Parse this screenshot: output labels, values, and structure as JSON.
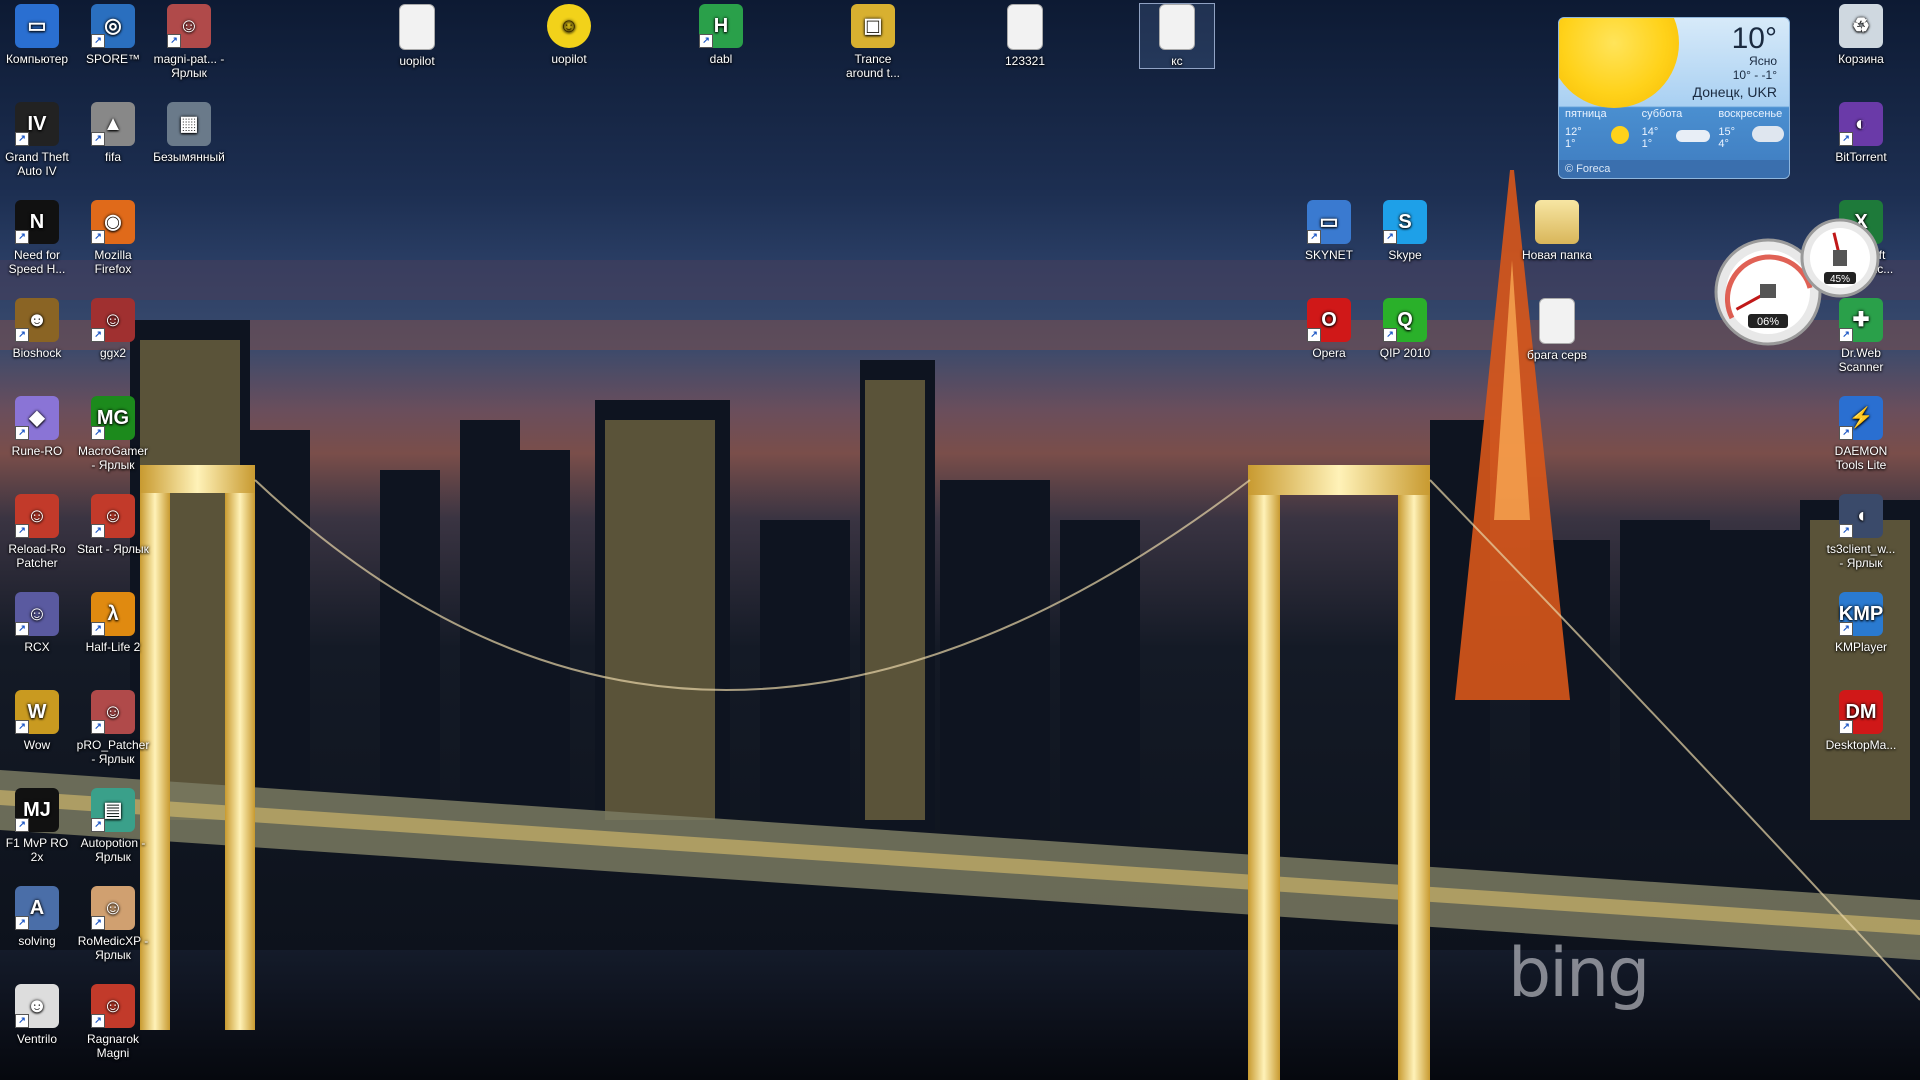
{
  "desktop": {
    "icons_left_col1": [
      {
        "label": "Компьютер",
        "icon": "computer-icon",
        "color": "#2a6fd1",
        "shortcut": false
      },
      {
        "label": "Grand Theft Auto IV",
        "icon": "gta4-icon",
        "color": "#222222",
        "shortcut": true
      },
      {
        "label": "Need for Speed H...",
        "icon": "nfs-icon",
        "color": "#111111",
        "shortcut": true
      },
      {
        "label": "Bioshock",
        "icon": "bioshock-icon",
        "color": "#8a6424",
        "shortcut": true
      },
      {
        "label": "Rune-RO",
        "icon": "rune-ro-icon",
        "color": "#8a74d6",
        "shortcut": true
      },
      {
        "label": "Reload-Ro Patcher",
        "icon": "reload-ro-icon",
        "color": "#c23a2a",
        "shortcut": true
      },
      {
        "label": "RCX",
        "icon": "rcx-icon",
        "color": "#5a5aa0",
        "shortcut": true
      },
      {
        "label": "Wow",
        "icon": "wow-icon",
        "color": "#c99a20",
        "shortcut": true
      },
      {
        "label": "F1 MvP RO 2x",
        "icon": "f1-mvp-icon",
        "color": "#111111",
        "shortcut": true
      },
      {
        "label": "solving",
        "icon": "solving-icon",
        "color": "#4a6ea8",
        "shortcut": true
      },
      {
        "label": "Ventrilo",
        "icon": "ventrilo-icon",
        "color": "#dddddd",
        "shortcut": true
      }
    ],
    "icons_left_col2": [
      {
        "label": "SPORE™",
        "icon": "spore-icon",
        "color": "#2a6fbf",
        "shortcut": true
      },
      {
        "label": "fifa",
        "icon": "fifa-icon",
        "color": "#888888",
        "shortcut": true
      },
      {
        "label": "Mozilla Firefox",
        "icon": "firefox-icon",
        "color": "#e06a1a",
        "shortcut": true
      },
      {
        "label": "ggx2",
        "icon": "ggx2-icon",
        "color": "#a03030",
        "shortcut": true
      },
      {
        "label": "MacroGamer - Ярлык",
        "icon": "macrogamer-icon",
        "color": "#1c8a1c",
        "shortcut": true
      },
      {
        "label": "Start - Ярлык",
        "icon": "start-icon",
        "color": "#c23a2a",
        "shortcut": true
      },
      {
        "label": "Half-Life 2",
        "icon": "half-life-icon",
        "color": "#e08a10",
        "shortcut": true
      },
      {
        "label": "pRO_Patcher - Ярлык",
        "icon": "pro-patcher-icon",
        "color": "#b04a4a",
        "shortcut": true
      },
      {
        "label": "Autopotion - Ярлык",
        "icon": "autopotion-icon",
        "color": "#3aa08a",
        "shortcut": true
      },
      {
        "label": "RoMedicXP - Ярлык",
        "icon": "romedic-icon",
        "color": "#d0a070",
        "shortcut": true
      },
      {
        "label": "Ragnarok Magni",
        "icon": "ragnarok-icon",
        "color": "#c23a2a",
        "shortcut": true
      }
    ],
    "icons_left_col3": [
      {
        "label": "magni-pat... - Ярлык",
        "icon": "magni-patcher-icon",
        "color": "#b04a4a",
        "shortcut": true
      },
      {
        "label": "Безымянный",
        "icon": "image-file-icon",
        "color": "#6a7a8a",
        "shortcut": false
      }
    ],
    "icons_top": [
      {
        "label": "uopilot",
        "icon": "text-file-icon",
        "color": "#f2f2f2",
        "shortcut": false
      },
      {
        "label": "uopilot",
        "icon": "smiley-icon",
        "color": "#f2d21a",
        "shortcut": false
      },
      {
        "label": "dabl",
        "icon": "dabl-icon",
        "color": "#2aa04a",
        "shortcut": true
      },
      {
        "label": "Trance around t...",
        "icon": "media-file-icon",
        "color": "#d8b030",
        "shortcut": false
      },
      {
        "label": "123321",
        "icon": "text-file-icon",
        "color": "#f2f2f2",
        "shortcut": false
      },
      {
        "label": "кс",
        "icon": "text-file-icon",
        "color": "#f2f2f2",
        "shortcut": false
      }
    ],
    "icons_mid": [
      {
        "label": "SKYNET",
        "icon": "network-computer-icon",
        "color": "#3a7ad0",
        "shortcut": true
      },
      {
        "label": "Skype",
        "icon": "skype-icon",
        "color": "#1ea0e8",
        "shortcut": true
      },
      {
        "label": "Новая папка",
        "icon": "folder-icon",
        "color": "#e8cc70",
        "shortcut": false
      },
      {
        "label": "Opera",
        "icon": "opera-icon",
        "color": "#d01818",
        "shortcut": true
      },
      {
        "label": "QIP 2010",
        "icon": "qip-icon",
        "color": "#2ab02a",
        "shortcut": true
      },
      {
        "label": "брага серв",
        "icon": "text-file-icon",
        "color": "#f2f2f2",
        "shortcut": false
      }
    ],
    "icons_right": [
      {
        "label": "Корзина",
        "icon": "recycle-bin-icon",
        "color": "#cfd8e0",
        "shortcut": false
      },
      {
        "label": "BitTorrent",
        "icon": "bittorrent-icon",
        "color": "#6a3aa8",
        "shortcut": true
      },
      {
        "label": "Microsoft Office Exc...",
        "icon": "excel-icon",
        "color": "#1e7a3a",
        "shortcut": true
      },
      {
        "label": "Dr.Web Scanner",
        "icon": "drweb-icon",
        "color": "#2aa04a",
        "shortcut": true
      },
      {
        "label": "DAEMON Tools Lite",
        "icon": "daemon-tools-icon",
        "color": "#2a6fd1",
        "shortcut": true
      },
      {
        "label": "ts3client_w... - Ярлык",
        "icon": "teamspeak-icon",
        "color": "#3a4a6a",
        "shortcut": true
      },
      {
        "label": "KMPlayer",
        "icon": "kmplayer-icon",
        "color": "#2a7ad0",
        "shortcut": true
      },
      {
        "label": "DesktopMa...",
        "icon": "desktop-master-icon",
        "color": "#d01818",
        "shortcut": true
      }
    ],
    "icon_glyphs": {
      "computer-icon": "▭",
      "gta4-icon": "IV",
      "nfs-icon": "N",
      "bioshock-icon": "☻",
      "rune-ro-icon": "◆",
      "reload-ro-icon": "☺",
      "rcx-icon": "☺",
      "wow-icon": "W",
      "f1-mvp-icon": "MJ",
      "solving-icon": "A",
      "ventrilo-icon": "☻",
      "spore-icon": "◎",
      "fifa-icon": "▲",
      "firefox-icon": "◉",
      "ggx2-icon": "☺",
      "macrogamer-icon": "MG",
      "start-icon": "☺",
      "half-life-icon": "λ",
      "pro-patcher-icon": "☺",
      "autopotion-icon": "▤",
      "romedic-icon": "☺",
      "ragnarok-icon": "☺",
      "magni-patcher-icon": "☺",
      "image-file-icon": "▦",
      "text-file-icon": "",
      "smiley-icon": "☺",
      "dabl-icon": "H",
      "media-file-icon": "▣",
      "network-computer-icon": "▭",
      "skype-icon": "S",
      "folder-icon": "",
      "opera-icon": "O",
      "qip-icon": "Q",
      "recycle-bin-icon": "♻",
      "bittorrent-icon": "◐",
      "excel-icon": "X",
      "drweb-icon": "✚",
      "daemon-tools-icon": "⚡",
      "teamspeak-icon": "◖",
      "kmplayer-icon": "KMP",
      "desktop-master-icon": "DM"
    }
  },
  "weather_gadget": {
    "temperature": "10°",
    "condition": "Ясно",
    "range": "10° - -1°",
    "city": "Донецк, UKR",
    "days": [
      {
        "name": "пятница",
        "temps": "12°\n1°",
        "icon": "sun-icon"
      },
      {
        "name": "суббота",
        "temps": "14°\n1°",
        "icon": "cloud-icon"
      },
      {
        "name": "воскресенье",
        "temps": "15°\n4°",
        "icon": "cloud-icon"
      }
    ],
    "footer": "© Foreca"
  },
  "cpu_gadget": {
    "cpu_label": "06%",
    "cpu_level": 0.06,
    "memory_label": "45%",
    "memory_level": 0.45
  },
  "wallpaper": {
    "watermark": "bing"
  }
}
